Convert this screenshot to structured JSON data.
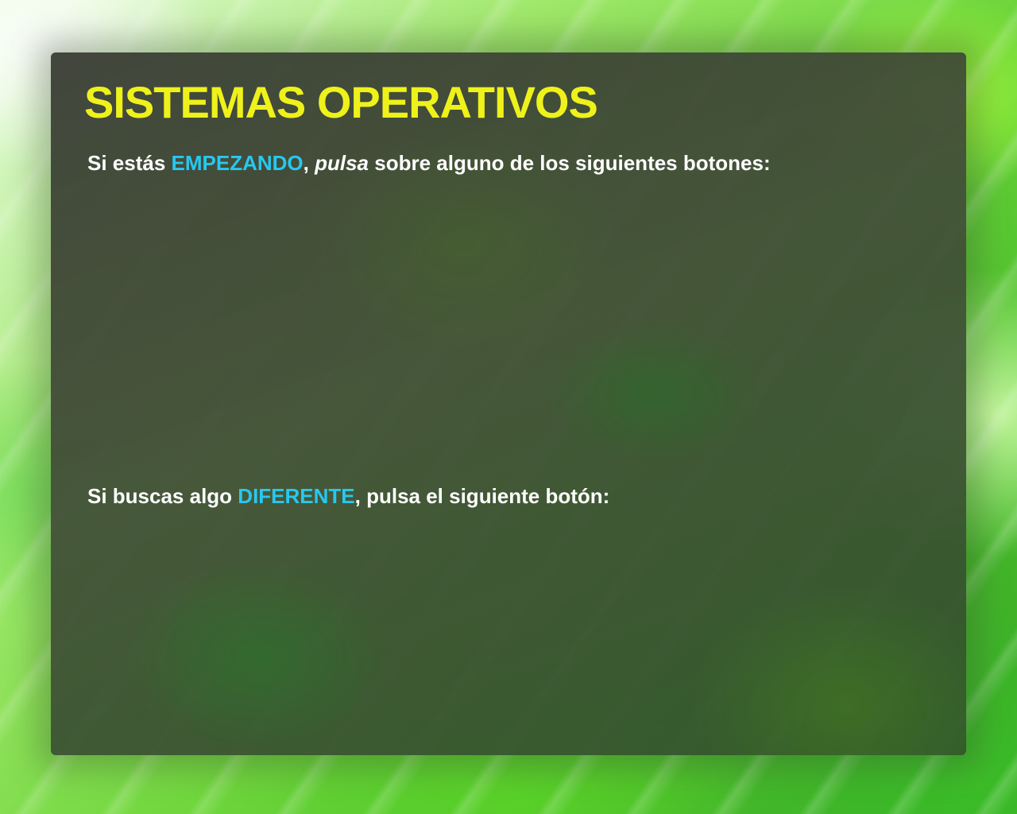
{
  "page": {
    "title": "SISTEMAS OPERATIVOS"
  },
  "intro_line": {
    "part1": "Si estás ",
    "highlight": "EMPEZANDO",
    "part2": ", ",
    "italic": "pulsa",
    "part3": " sobre alguno de los siguientes botones:"
  },
  "different_line": {
    "part1": "Si buscas algo ",
    "highlight": "DIFERENTE",
    "part2": ", pulsa el siguiente botón:"
  },
  "colors": {
    "title": "#eef21a",
    "highlight": "#27c8f0",
    "text": "#ffffff",
    "panel": "#3f4a36",
    "background": "#6fd63c"
  }
}
